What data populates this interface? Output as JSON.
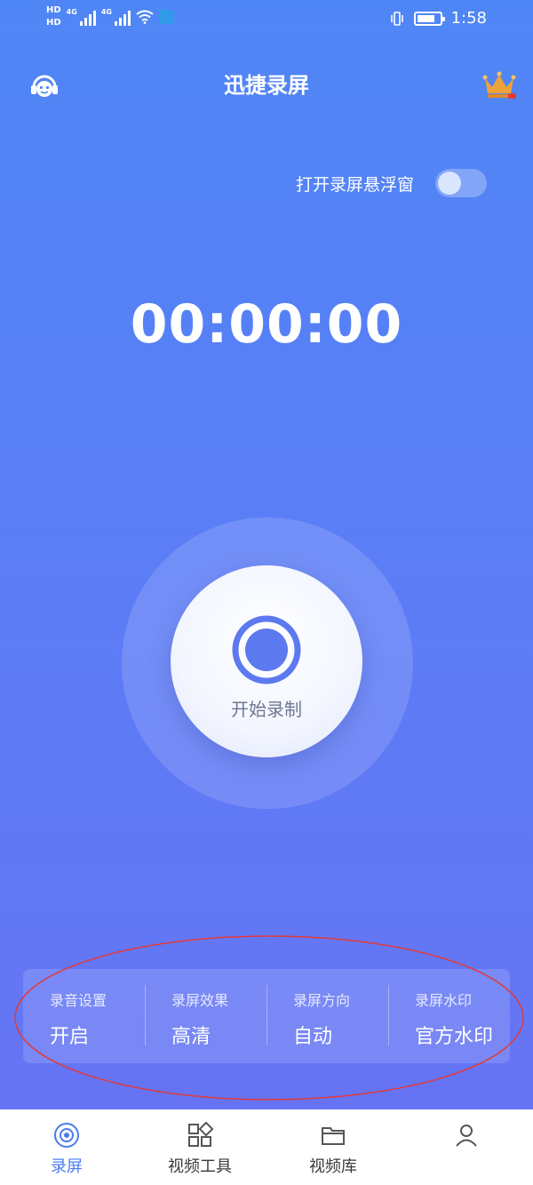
{
  "status_bar": {
    "hd_top": "HD",
    "hd_bottom": "HD",
    "net_1": "4G",
    "net_2": "4G",
    "time": "1:58"
  },
  "header": {
    "title": "迅捷录屏"
  },
  "floating_window": {
    "label": "打开录屏悬浮窗",
    "enabled": false
  },
  "timer": "00:00:00",
  "record_button": {
    "label": "开始录制"
  },
  "settings": [
    {
      "title": "录音设置",
      "value": "开启"
    },
    {
      "title": "录屏效果",
      "value": "高清"
    },
    {
      "title": "录屏方向",
      "value": "自动"
    },
    {
      "title": "录屏水印",
      "value": "官方水印"
    }
  ],
  "bottom_nav": [
    {
      "label": "录屏",
      "icon": "disc-icon",
      "active": true
    },
    {
      "label": "视频工具",
      "icon": "grid-icon",
      "active": false
    },
    {
      "label": "视频库",
      "icon": "folder-icon",
      "active": false
    },
    {
      "label": "",
      "icon": "user-icon",
      "active": false
    }
  ],
  "colors": {
    "accent": "#4a7cf0",
    "background_top": "#4f86f5",
    "background_bottom": "#6674f4",
    "annotation": "#e23a3a",
    "crown": "#f0a23a"
  }
}
